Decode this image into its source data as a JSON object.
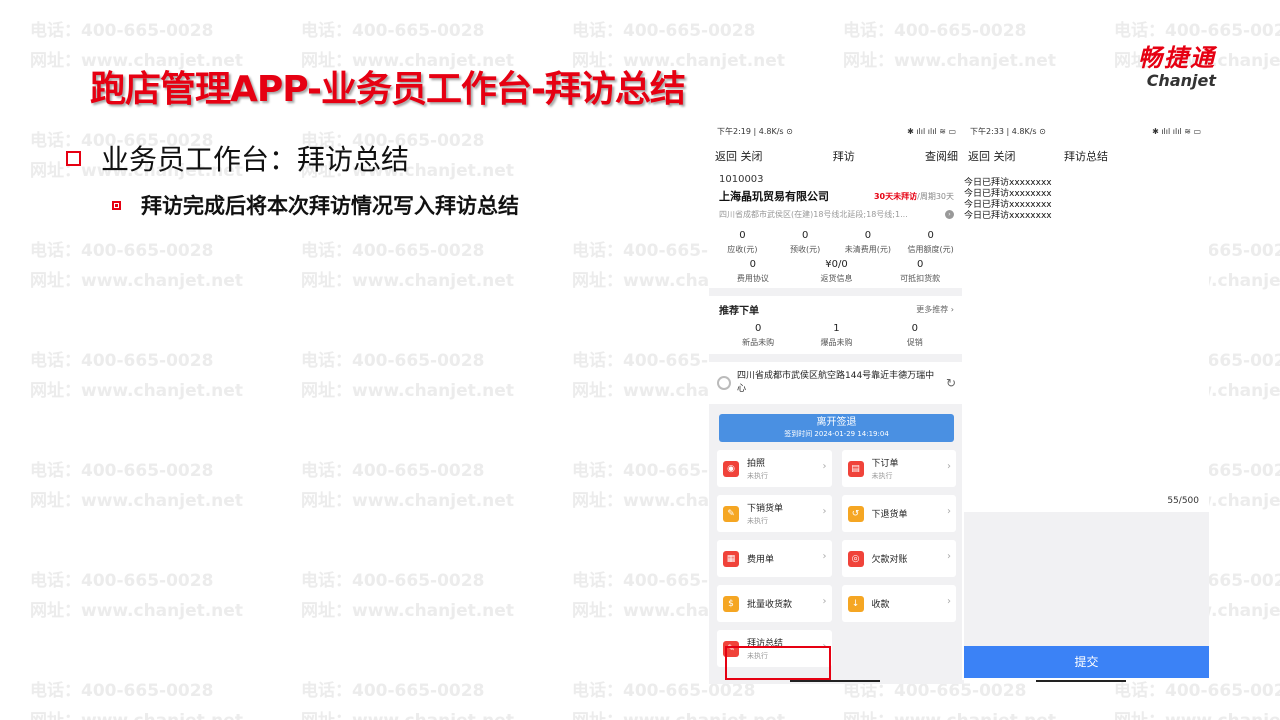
{
  "watermark": {
    "phone": "电话：400-665-0028",
    "site": "网址：www.chanjet.net"
  },
  "slide": {
    "title": "跑店管理APP-业务员工作台-拜访总结",
    "bullet1": "业务员工作台：拜访总结",
    "bullet2": "拜访完成后将本次拜访情况写入拜访总结",
    "logo_cn": "畅捷通",
    "logo_en": "Chanjet"
  },
  "phone1": {
    "status_time": "下午2:19 | 4.8K/s ⊙",
    "status_icons": "✱ ılıl ılıl ≋ ▭",
    "nav": {
      "back": "返回",
      "close": "关闭",
      "title": "拜访",
      "detail": "查阅细"
    },
    "customer": {
      "id": "1010003",
      "name": "上海晶玑贸易有限公司",
      "visit_days": "30天未拜访",
      "visit_cycle": "/周期30天",
      "address": "四川省成都市武侯区(在建)18号线北延段;18号线;1..."
    },
    "metrics_row1": [
      {
        "value": "0",
        "label": "应收(元)"
      },
      {
        "value": "0",
        "label": "预收(元)"
      },
      {
        "value": "0",
        "label": "未清费用(元)"
      },
      {
        "value": "0",
        "label": "信用额度(元)"
      }
    ],
    "metrics_row2": [
      {
        "value": "0",
        "label": "费用协议"
      },
      {
        "value": "¥0/0",
        "label": "返货信息"
      },
      {
        "value": "0",
        "label": "可抵扣货款"
      }
    ],
    "recommend": {
      "title": "推荐下单",
      "more": "更多推荐 ›",
      "items": [
        {
          "value": "0",
          "label": "新品未购"
        },
        {
          "value": "1",
          "label": "爆品未购"
        },
        {
          "value": "0",
          "label": "促销"
        }
      ]
    },
    "location": "四川省成都市武侯区航空路144号靠近丰德万瑞中心",
    "leave_button": {
      "label": "离开签退",
      "time": "签到时间 2024-01-29 14:19:04"
    },
    "tiles": [
      {
        "name": "拍照",
        "status": "未执行",
        "icon": "camera-icon"
      },
      {
        "name": "下订单",
        "status": "未执行",
        "icon": "order-icon"
      },
      {
        "name": "下销货单",
        "status": "未执行",
        "icon": "sales-icon"
      },
      {
        "name": "下退货单",
        "status": "",
        "icon": "return-icon"
      },
      {
        "name": "费用单",
        "status": "",
        "icon": "expense-icon"
      },
      {
        "name": "欠款对账",
        "status": "",
        "icon": "debt-icon"
      },
      {
        "name": "批量收货款",
        "status": "",
        "icon": "money-bag-icon"
      },
      {
        "name": "收款",
        "status": "",
        "icon": "collect-icon"
      },
      {
        "name": "拜访总结",
        "status": "未执行",
        "icon": "summary-icon"
      }
    ]
  },
  "phone2": {
    "status_time": "下午2:33 | 4.8K/s ⊙",
    "status_icons": "✱ ılıl ılıl ≋ ▭",
    "nav": {
      "back": "返回",
      "close": "关闭",
      "title": "拜访总结"
    },
    "summary_lines": [
      "今日已拜访xxxxxxxx",
      "今日已拜访xxxxxxxx",
      "今日已拜访xxxxxxxx",
      "今日已拜访xxxxxxxx"
    ],
    "counter": "55/500",
    "submit": "提交"
  },
  "colors": {
    "brand_red": "#e60012",
    "accent_blue": "#3b82f6"
  }
}
